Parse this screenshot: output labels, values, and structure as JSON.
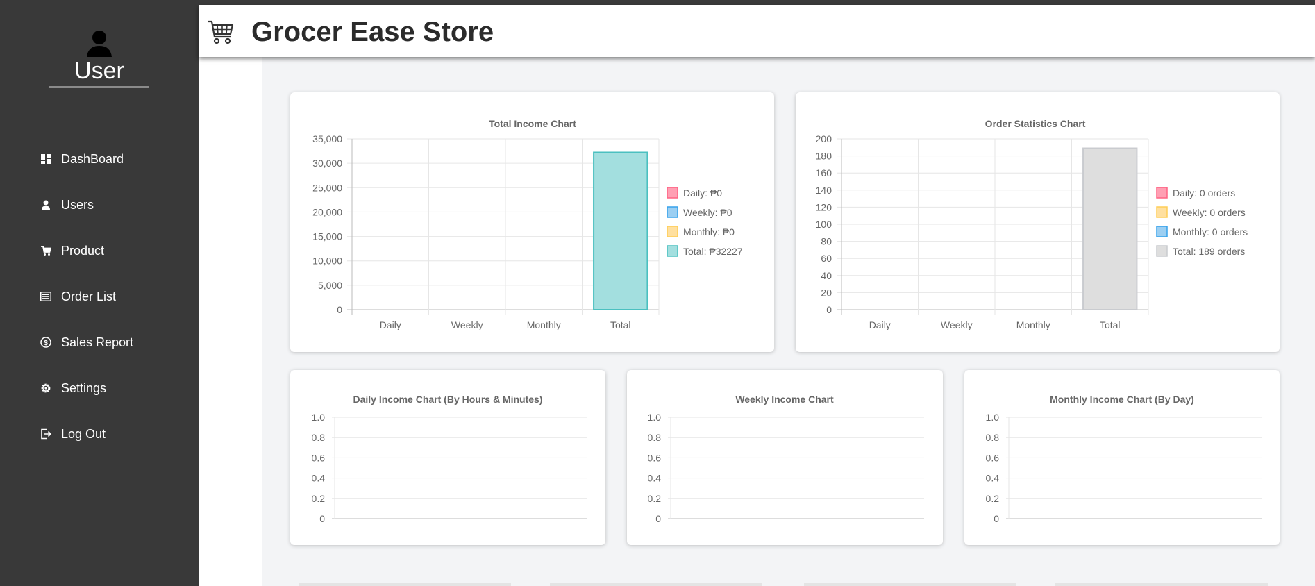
{
  "app": {
    "title": "Grocer Ease Store"
  },
  "user": {
    "name": "User"
  },
  "sidebar": {
    "items": [
      {
        "label": "DashBoard",
        "icon": "dashboard-icon"
      },
      {
        "label": "Users",
        "icon": "user-icon"
      },
      {
        "label": "Product",
        "icon": "cart-icon"
      },
      {
        "label": "Order List",
        "icon": "list-icon"
      },
      {
        "label": "Sales Report",
        "icon": "dollar-icon"
      },
      {
        "label": "Settings",
        "icon": "gear-icon"
      },
      {
        "label": "Log Out",
        "icon": "logout-icon"
      }
    ]
  },
  "chart_data": [
    {
      "type": "bar",
      "title": "Total Income Chart",
      "categories": [
        "Daily",
        "Weekly",
        "Monthly",
        "Total"
      ],
      "values": [
        0,
        0,
        0,
        32227
      ],
      "ylim": [
        0,
        35000
      ],
      "yticks": [
        "35,000",
        "30,000",
        "25,000",
        "20,000",
        "15,000",
        "10,000",
        "5,000",
        "0"
      ],
      "legend": [
        "Daily: ₱0",
        "Weekly: ₱0",
        "Monthly: ₱0",
        "Total: ₱32227"
      ],
      "legend_position": "right",
      "colors": [
        "#ff9fb3",
        "#9ccff2",
        "#ffe0a0",
        "#a3dfdf"
      ],
      "border_colors": [
        "#ff6384",
        "#36a2eb",
        "#ffce56",
        "#4bc0c0"
      ]
    },
    {
      "type": "bar",
      "title": "Order Statistics Chart",
      "categories": [
        "Daily",
        "Weekly",
        "Monthly",
        "Total"
      ],
      "values": [
        0,
        0,
        0,
        189
      ],
      "ylim": [
        0,
        200
      ],
      "yticks": [
        "200",
        "180",
        "160",
        "140",
        "120",
        "100",
        "80",
        "60",
        "40",
        "20",
        "0"
      ],
      "legend": [
        "Daily: 0 orders",
        "Weekly: 0 orders",
        "Monthly: 0 orders",
        "Total: 189 orders"
      ],
      "legend_position": "right",
      "colors": [
        "#ff9fb3",
        "#ffe0a0",
        "#9ccff2",
        "#dedede"
      ],
      "border_colors": [
        "#ff6384",
        "#ffce56",
        "#36a2eb",
        "#c9cbcf"
      ]
    },
    {
      "type": "line",
      "title": "Daily Income Chart (By Hours & Minutes)",
      "series": [],
      "ylim": [
        0,
        1
      ],
      "yticks": [
        "1.0",
        "0.8",
        "0.6",
        "0.4",
        "0.2",
        "0"
      ]
    },
    {
      "type": "line",
      "title": "Weekly Income Chart",
      "series": [],
      "ylim": [
        0,
        1
      ],
      "yticks": [
        "1.0",
        "0.8",
        "0.6",
        "0.4",
        "0.2",
        "0"
      ]
    },
    {
      "type": "line",
      "title": "Monthly Income Chart (By Day)",
      "series": [],
      "ylim": [
        0,
        1
      ],
      "yticks": [
        "1.0",
        "0.8",
        "0.6",
        "0.4",
        "0.2",
        "0"
      ]
    }
  ]
}
